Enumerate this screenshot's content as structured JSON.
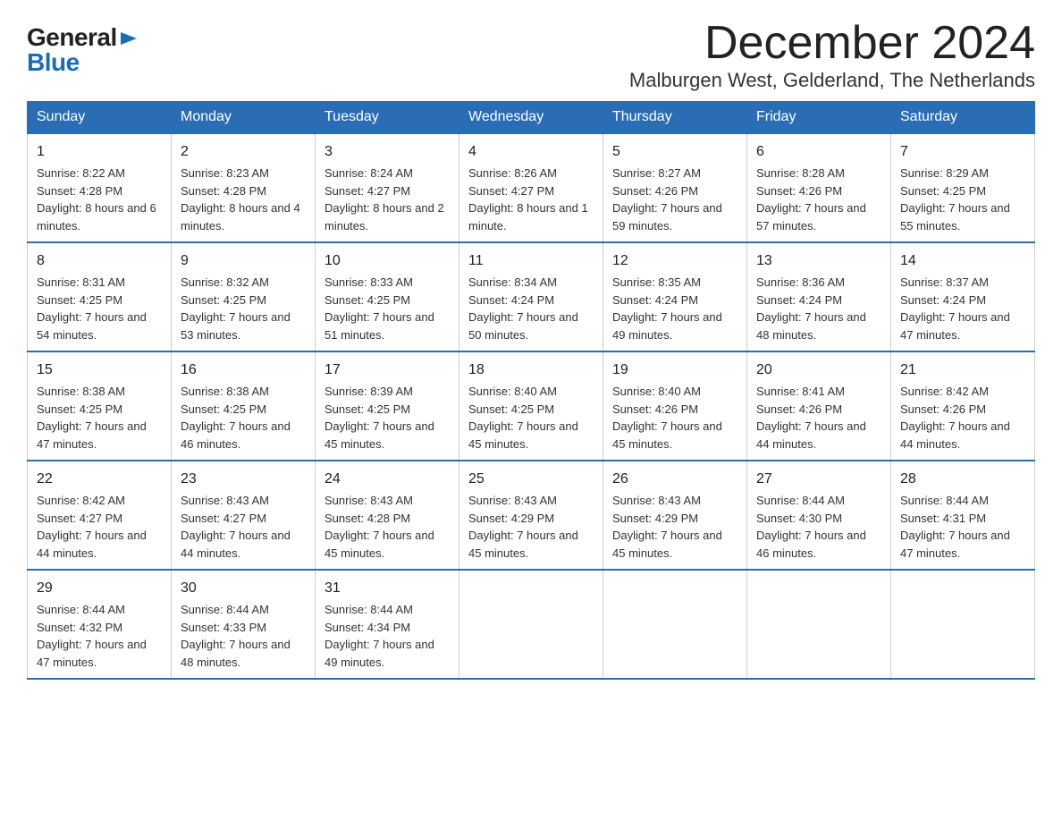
{
  "logo": {
    "general": "General",
    "blue": "Blue",
    "arrow": "▶"
  },
  "title": "December 2024",
  "subtitle": "Malburgen West, Gelderland, The Netherlands",
  "days_of_week": [
    "Sunday",
    "Monday",
    "Tuesday",
    "Wednesday",
    "Thursday",
    "Friday",
    "Saturday"
  ],
  "weeks": [
    [
      {
        "day": "1",
        "sunrise": "8:22 AM",
        "sunset": "4:28 PM",
        "daylight": "8 hours and 6 minutes."
      },
      {
        "day": "2",
        "sunrise": "8:23 AM",
        "sunset": "4:28 PM",
        "daylight": "8 hours and 4 minutes."
      },
      {
        "day": "3",
        "sunrise": "8:24 AM",
        "sunset": "4:27 PM",
        "daylight": "8 hours and 2 minutes."
      },
      {
        "day": "4",
        "sunrise": "8:26 AM",
        "sunset": "4:27 PM",
        "daylight": "8 hours and 1 minute."
      },
      {
        "day": "5",
        "sunrise": "8:27 AM",
        "sunset": "4:26 PM",
        "daylight": "7 hours and 59 minutes."
      },
      {
        "day": "6",
        "sunrise": "8:28 AM",
        "sunset": "4:26 PM",
        "daylight": "7 hours and 57 minutes."
      },
      {
        "day": "7",
        "sunrise": "8:29 AM",
        "sunset": "4:25 PM",
        "daylight": "7 hours and 55 minutes."
      }
    ],
    [
      {
        "day": "8",
        "sunrise": "8:31 AM",
        "sunset": "4:25 PM",
        "daylight": "7 hours and 54 minutes."
      },
      {
        "day": "9",
        "sunrise": "8:32 AM",
        "sunset": "4:25 PM",
        "daylight": "7 hours and 53 minutes."
      },
      {
        "day": "10",
        "sunrise": "8:33 AM",
        "sunset": "4:25 PM",
        "daylight": "7 hours and 51 minutes."
      },
      {
        "day": "11",
        "sunrise": "8:34 AM",
        "sunset": "4:24 PM",
        "daylight": "7 hours and 50 minutes."
      },
      {
        "day": "12",
        "sunrise": "8:35 AM",
        "sunset": "4:24 PM",
        "daylight": "7 hours and 49 minutes."
      },
      {
        "day": "13",
        "sunrise": "8:36 AM",
        "sunset": "4:24 PM",
        "daylight": "7 hours and 48 minutes."
      },
      {
        "day": "14",
        "sunrise": "8:37 AM",
        "sunset": "4:24 PM",
        "daylight": "7 hours and 47 minutes."
      }
    ],
    [
      {
        "day": "15",
        "sunrise": "8:38 AM",
        "sunset": "4:25 PM",
        "daylight": "7 hours and 47 minutes."
      },
      {
        "day": "16",
        "sunrise": "8:38 AM",
        "sunset": "4:25 PM",
        "daylight": "7 hours and 46 minutes."
      },
      {
        "day": "17",
        "sunrise": "8:39 AM",
        "sunset": "4:25 PM",
        "daylight": "7 hours and 45 minutes."
      },
      {
        "day": "18",
        "sunrise": "8:40 AM",
        "sunset": "4:25 PM",
        "daylight": "7 hours and 45 minutes."
      },
      {
        "day": "19",
        "sunrise": "8:40 AM",
        "sunset": "4:26 PM",
        "daylight": "7 hours and 45 minutes."
      },
      {
        "day": "20",
        "sunrise": "8:41 AM",
        "sunset": "4:26 PM",
        "daylight": "7 hours and 44 minutes."
      },
      {
        "day": "21",
        "sunrise": "8:42 AM",
        "sunset": "4:26 PM",
        "daylight": "7 hours and 44 minutes."
      }
    ],
    [
      {
        "day": "22",
        "sunrise": "8:42 AM",
        "sunset": "4:27 PM",
        "daylight": "7 hours and 44 minutes."
      },
      {
        "day": "23",
        "sunrise": "8:43 AM",
        "sunset": "4:27 PM",
        "daylight": "7 hours and 44 minutes."
      },
      {
        "day": "24",
        "sunrise": "8:43 AM",
        "sunset": "4:28 PM",
        "daylight": "7 hours and 45 minutes."
      },
      {
        "day": "25",
        "sunrise": "8:43 AM",
        "sunset": "4:29 PM",
        "daylight": "7 hours and 45 minutes."
      },
      {
        "day": "26",
        "sunrise": "8:43 AM",
        "sunset": "4:29 PM",
        "daylight": "7 hours and 45 minutes."
      },
      {
        "day": "27",
        "sunrise": "8:44 AM",
        "sunset": "4:30 PM",
        "daylight": "7 hours and 46 minutes."
      },
      {
        "day": "28",
        "sunrise": "8:44 AM",
        "sunset": "4:31 PM",
        "daylight": "7 hours and 47 minutes."
      }
    ],
    [
      {
        "day": "29",
        "sunrise": "8:44 AM",
        "sunset": "4:32 PM",
        "daylight": "7 hours and 47 minutes."
      },
      {
        "day": "30",
        "sunrise": "8:44 AM",
        "sunset": "4:33 PM",
        "daylight": "7 hours and 48 minutes."
      },
      {
        "day": "31",
        "sunrise": "8:44 AM",
        "sunset": "4:34 PM",
        "daylight": "7 hours and 49 minutes."
      },
      null,
      null,
      null,
      null
    ]
  ]
}
